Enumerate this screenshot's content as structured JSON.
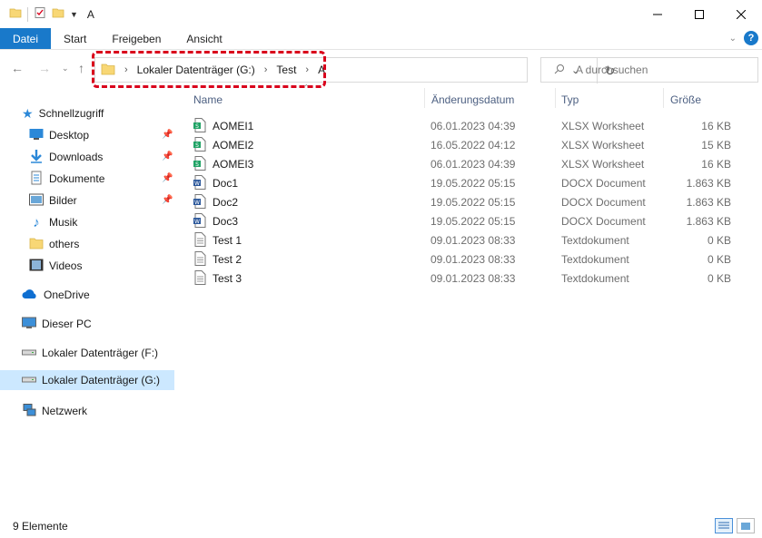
{
  "window": {
    "title": "A"
  },
  "ribbon": {
    "tabs": [
      "Datei",
      "Start",
      "Freigeben",
      "Ansicht"
    ],
    "help_label": "?"
  },
  "address": {
    "crumbs": [
      "Lokaler Datenträger (G:)",
      "Test",
      "A"
    ]
  },
  "search": {
    "placeholder": "A durchsuchen"
  },
  "nav": {
    "quick_access": "Schnellzugriff",
    "quick_items": [
      {
        "label": "Desktop",
        "icon": "desktop-icon",
        "pinned": true
      },
      {
        "label": "Downloads",
        "icon": "download-icon",
        "pinned": true
      },
      {
        "label": "Dokumente",
        "icon": "document-icon",
        "pinned": true
      },
      {
        "label": "Bilder",
        "icon": "pictures-icon",
        "pinned": true
      },
      {
        "label": "Musik",
        "icon": "music-icon",
        "pinned": false
      },
      {
        "label": "others",
        "icon": "folder-icon",
        "pinned": false
      },
      {
        "label": "Videos",
        "icon": "video-icon",
        "pinned": false
      }
    ],
    "onedrive": "OneDrive",
    "this_pc": "Dieser PC",
    "drive_f": "Lokaler Datenträger (F:)",
    "drive_g": "Lokaler Datenträger (G:)",
    "network": "Netzwerk"
  },
  "columns": {
    "name": "Name",
    "date": "Änderungsdatum",
    "type": "Typ",
    "size": "Größe"
  },
  "files": [
    {
      "name": "AOMEI1",
      "date": "06.01.2023 04:39",
      "type": "XLSX Worksheet",
      "size": "16 KB",
      "kind": "xlsx"
    },
    {
      "name": "AOMEI2",
      "date": "16.05.2022 04:12",
      "type": "XLSX Worksheet",
      "size": "15 KB",
      "kind": "xlsx"
    },
    {
      "name": "AOMEI3",
      "date": "06.01.2023 04:39",
      "type": "XLSX Worksheet",
      "size": "16 KB",
      "kind": "xlsx"
    },
    {
      "name": "Doc1",
      "date": "19.05.2022 05:15",
      "type": "DOCX Document",
      "size": "1.863 KB",
      "kind": "docx"
    },
    {
      "name": "Doc2",
      "date": "19.05.2022 05:15",
      "type": "DOCX Document",
      "size": "1.863 KB",
      "kind": "docx"
    },
    {
      "name": "Doc3",
      "date": "19.05.2022 05:15",
      "type": "DOCX Document",
      "size": "1.863 KB",
      "kind": "docx"
    },
    {
      "name": "Test 1",
      "date": "09.01.2023 08:33",
      "type": "Textdokument",
      "size": "0 KB",
      "kind": "txt"
    },
    {
      "name": "Test 2",
      "date": "09.01.2023 08:33",
      "type": "Textdokument",
      "size": "0 KB",
      "kind": "txt"
    },
    {
      "name": "Test 3",
      "date": "09.01.2023 08:33",
      "type": "Textdokument",
      "size": "0 KB",
      "kind": "txt"
    }
  ],
  "status": {
    "count": "9 Elemente"
  },
  "colors": {
    "accent": "#1979ca",
    "highlight": "#d9001b",
    "selected": "#cce8ff"
  }
}
